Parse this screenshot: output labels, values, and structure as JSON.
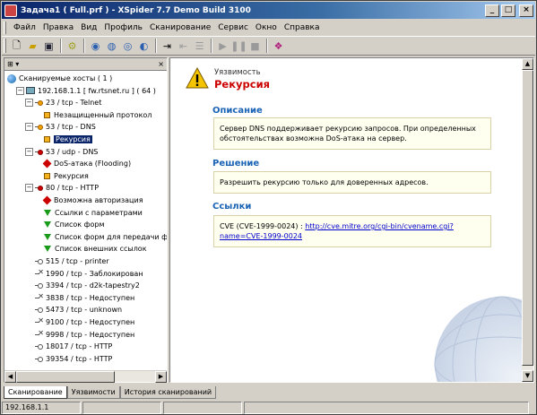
{
  "window": {
    "title": "Задача1 ( Full.prf ) - XSpider 7.7 Demo Build 3100",
    "minimize": "_",
    "maximize": "□",
    "close": "×"
  },
  "menu": [
    "Файл",
    "Правка",
    "Вид",
    "Профиль",
    "Сканирование",
    "Сервис",
    "Окно",
    "Справка"
  ],
  "toolbar_icons": [
    "new-document-icon",
    "open-folder-icon",
    "save-icon",
    "scan-hosts-icon",
    "add-host-icon",
    "add-range-icon",
    "host-search-icon",
    "host-config-icon",
    "step-icon",
    "step-back-icon",
    "step-list-icon",
    "play-icon",
    "pause-icon",
    "stop-icon",
    "book-icon"
  ],
  "left_pane": {
    "header": "⊞ ▾",
    "close": "×",
    "tree": [
      {
        "id": "root",
        "text": "Сканируемые хосты ( 1 )",
        "icon": "network-icon",
        "indent": 0
      },
      {
        "id": "host",
        "text": "192.168.1.1 [ fw.rtsnet.ru ] ( 64 )",
        "icon": "computer-icon",
        "indent": 1,
        "exp": "−"
      },
      {
        "id": "p23",
        "text": "23 / tcp - Telnet",
        "icon": "port-orange",
        "indent": 2,
        "exp": "−"
      },
      {
        "id": "p23a",
        "text": "Незащищенный протокол",
        "icon": "sq",
        "indent": 3
      },
      {
        "id": "p53t",
        "text": "53 / tcp - DNS",
        "icon": "port-orange",
        "indent": 2,
        "exp": "−"
      },
      {
        "id": "p53ta",
        "text": "Рекурсия",
        "icon": "sq",
        "indent": 3,
        "selected": true
      },
      {
        "id": "p53u",
        "text": "53 / udp - DNS",
        "icon": "port-red",
        "indent": 2,
        "exp": "−"
      },
      {
        "id": "p53ua",
        "text": "DoS-атака (Flooding)",
        "icon": "dia",
        "indent": 3
      },
      {
        "id": "p53ub",
        "text": "Рекурсия",
        "icon": "sq",
        "indent": 3
      },
      {
        "id": "p80",
        "text": "80 / tcp - HTTP",
        "icon": "port-red",
        "indent": 2,
        "exp": "−"
      },
      {
        "id": "p80a",
        "text": "Возможна авторизация",
        "icon": "dia",
        "indent": 3
      },
      {
        "id": "p80b",
        "text": "Ссылки с параметрами",
        "icon": "grn",
        "indent": 3
      },
      {
        "id": "p80c",
        "text": "Список форм",
        "icon": "grn",
        "indent": 3
      },
      {
        "id": "p80d",
        "text": "Список форм для передачи фа",
        "icon": "grn",
        "indent": 3
      },
      {
        "id": "p80e",
        "text": "Список внешних ссылок",
        "icon": "grn",
        "indent": 3
      },
      {
        "id": "p515",
        "text": "515 / tcp - printer",
        "icon": "port",
        "indent": 2
      },
      {
        "id": "p1990",
        "text": "1990 / tcp - Заблокирован",
        "icon": "blk",
        "indent": 2
      },
      {
        "id": "p3394",
        "text": "3394 / tcp - d2k-tapestry2",
        "icon": "port",
        "indent": 2
      },
      {
        "id": "p3838",
        "text": "3838 / tcp - Недоступен",
        "icon": "blk",
        "indent": 2
      },
      {
        "id": "p5473",
        "text": "5473 / tcp - unknown",
        "icon": "port",
        "indent": 2
      },
      {
        "id": "p9100",
        "text": "9100 / tcp - Недоступен",
        "icon": "blk",
        "indent": 2
      },
      {
        "id": "p9998",
        "text": "9998 / tcp - Недоступен",
        "icon": "blk",
        "indent": 2
      },
      {
        "id": "p18017",
        "text": "18017 / tcp - HTTP",
        "icon": "port",
        "indent": 2
      },
      {
        "id": "p39354",
        "text": "39354 / tcp - HTTP",
        "icon": "port",
        "indent": 2
      }
    ]
  },
  "detail": {
    "label": "Уязвимость",
    "title": "Рекурсия",
    "description_heading": "Описание",
    "description": "Сервер DNS поддерживает рекурсию запросов. При определенных обстоятельствах возможна DoS-атака на сервер.",
    "solution_heading": "Решение",
    "solution": "Разрешить рекурсию только для доверенных адресов.",
    "links_heading": "Ссылки",
    "link_prefix": "CVE (CVE-1999-0024) : ",
    "link_url": "http://cve.mitre.org/cgi-bin/cvename.cgi?name=CVE-1999-0024"
  },
  "tabs": [
    "Сканирование",
    "Уязвимости",
    "История сканирований"
  ],
  "status": {
    "ip": "192.168.1.1"
  },
  "colors": {
    "accent_title": "#c00000",
    "section": "#1a63b5",
    "selection": "#0a246a"
  }
}
